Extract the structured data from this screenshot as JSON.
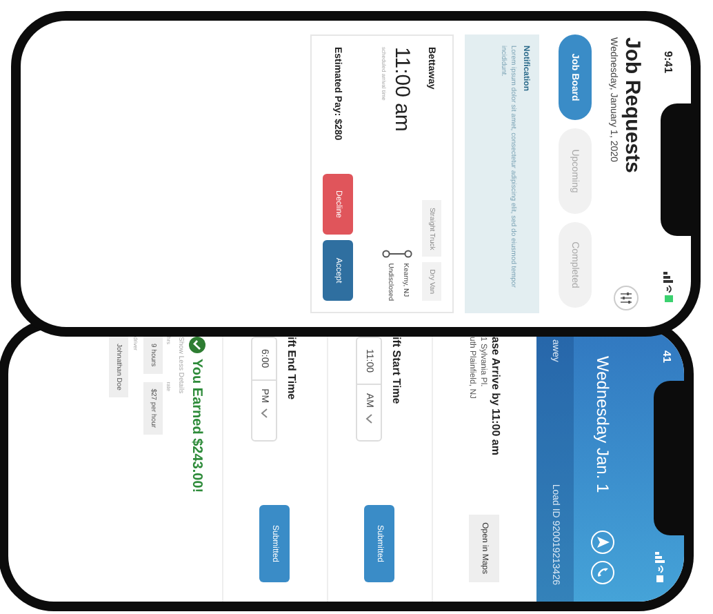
{
  "job_requests_screen": {
    "status_time": "9:41",
    "title": "Job Requests",
    "date": "Wednesday, January 1, 2020",
    "tabs": [
      {
        "label": "Job Board",
        "selected": true
      },
      {
        "label": "Upcoming",
        "selected": false
      },
      {
        "label": "Completed",
        "selected": false
      }
    ],
    "notification": {
      "title": "Notification",
      "body": "Lorem ipsum dolor sit amet, consectetur adipiscing elit, sed do eiusmod tempor incididunt."
    },
    "jobs": [
      {
        "company": "Bettaway",
        "tags": [
          "Straight Truck",
          "Dry Van"
        ],
        "time": "11:00 am",
        "time_note": "scheduled arrival time",
        "route": [
          "Kearny, NJ",
          "Undisclosed"
        ],
        "estimated_pay": "Estimated Pay: $280",
        "actions": [
          {
            "label": "Decline",
            "kind": "decline"
          },
          {
            "label": "Accept",
            "kind": "accept"
          }
        ]
      }
    ]
  },
  "shift_screen": {
    "status_time": "41",
    "title": "Wednesday Jan. 1",
    "company": "awey",
    "load_id": "Load ID 920019213426",
    "arrival": {
      "heading": "ase Arrive by 11:00 am",
      "address": [
        "1 Sylvania Pl.",
        "uth Plainfield, NJ"
      ],
      "maps_button": "Open in Maps"
    },
    "time_sections": [
      {
        "heading": "ift Start Time",
        "time": "11:00",
        "period": "AM",
        "button": "Submitted"
      },
      {
        "heading": "ift End Time",
        "time": "6:00",
        "period": "PM",
        "button": "Submitted"
      }
    ],
    "earnings": {
      "title": "You Earned $243.00!",
      "toggle": "Show Less Details",
      "fields": [
        {
          "label": "hrs",
          "value": "9 hours"
        },
        {
          "label": "rate",
          "value": "$27 per hour"
        }
      ],
      "driver_label": "driver",
      "driver": "Johnathan Doe"
    }
  }
}
